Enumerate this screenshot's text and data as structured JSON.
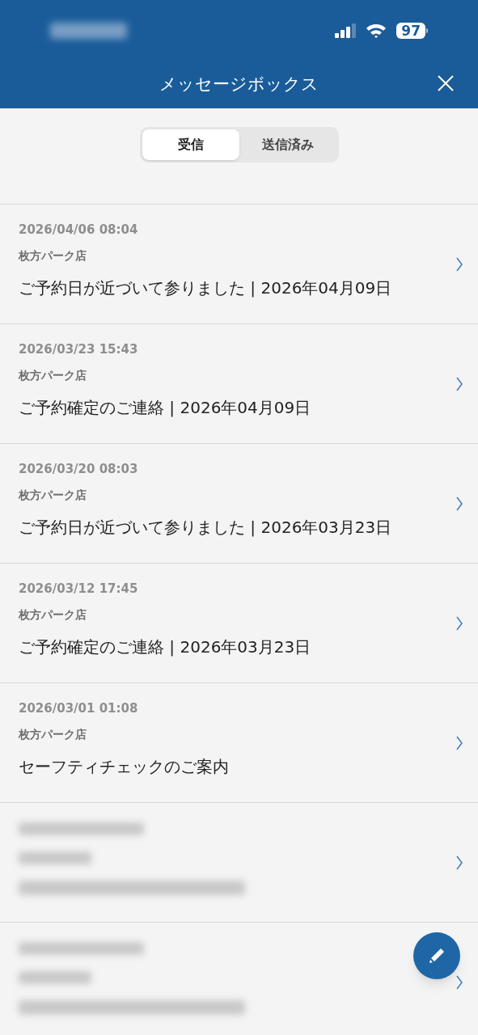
{
  "status_bar": {
    "battery": "97"
  },
  "header": {
    "title": "メッセージボックス"
  },
  "tabs": [
    {
      "label": "受信",
      "selected": true
    },
    {
      "label": "送信済み",
      "selected": false
    }
  ],
  "messages": [
    {
      "kind": "message",
      "date": "2026/04/06 08:04",
      "store": "枚方パーク店",
      "subject": "ご予約日が近づいて参りました | 2026年04月09日"
    },
    {
      "kind": "message",
      "date": "2026/03/23 15:43",
      "store": "枚方パーク店",
      "subject": "ご予約確定のご連絡 | 2026年04月09日"
    },
    {
      "kind": "message",
      "date": "2026/03/20 08:03",
      "store": "枚方パーク店",
      "subject": "ご予約日が近づいて参りました | 2026年03月23日"
    },
    {
      "kind": "message",
      "date": "2026/03/12 17:45",
      "store": "枚方パーク店",
      "subject": "ご予約確定のご連絡 | 2026年03月23日"
    },
    {
      "kind": "message",
      "date": "2026/03/01 01:08",
      "store": "枚方パーク店",
      "subject": "セーフティチェックのご案内"
    },
    {
      "kind": "redacted"
    },
    {
      "kind": "redacted"
    }
  ]
}
